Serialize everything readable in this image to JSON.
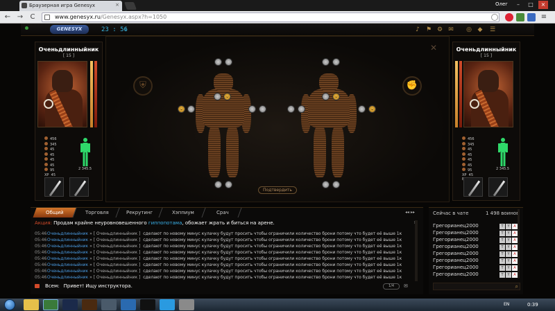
{
  "browser": {
    "tab_title": "Браузерная игра Genesyx",
    "tab_close": "×",
    "url_host": "www.genesyx.ru",
    "url_path": "/Genesyx.aspx?h=1050",
    "user_name": "Олег",
    "nav_back": "←",
    "nav_forward": "→",
    "nav_reload": "C",
    "win_min": "–",
    "win_max": "□",
    "win_close": "×"
  },
  "game": {
    "logo_text": "GENESYX",
    "clock": "23 : 56",
    "top_icons": [
      "♪",
      "⚑",
      "⚙",
      "✉",
      "◎",
      "◆",
      "☰"
    ],
    "close_label": "✕",
    "confirm_label": "Подтвердить",
    "left_badge": "⛨",
    "right_badge": "✊"
  },
  "player_left": {
    "name": "Оченьдлинныйник",
    "level": "[ 15 ]",
    "stats": [
      {
        "v": "456"
      },
      {
        "v": "345"
      },
      {
        "v": "45"
      },
      {
        "v": "45"
      },
      {
        "v": "45"
      },
      {
        "v": "45"
      },
      {
        "v": "95"
      }
    ],
    "xp_label": "XP",
    "xp": "45",
    "en_label": "EN",
    "en": "98",
    "armor_value": "2 345.5",
    "hp_color": "#e0a040",
    "bar2_color": "#b63a1a"
  },
  "player_right": {
    "name": "Оченьдлинныйник",
    "level": "[ 15 ]",
    "stats": [
      {
        "v": "456"
      },
      {
        "v": "345"
      },
      {
        "v": "45"
      },
      {
        "v": "45"
      },
      {
        "v": "45"
      },
      {
        "v": "45"
      },
      {
        "v": "95"
      }
    ],
    "xp_label": "XP",
    "xp": "45",
    "en_label": "EN",
    "en": "98",
    "armor_value": "2 345.5"
  },
  "chat": {
    "tabs": [
      "Общий",
      "Торговля",
      "Рекрутинг",
      "Хэппиум",
      "Срач"
    ],
    "active_tab": 0,
    "tab_nav": "◂◂  ▸▸",
    "promo_label": "Акция:",
    "promo_before": "Продам крайне неуровновешенного",
    "promo_link": "гиппопотама",
    "promo_after": ", обожает жрать и биться на арене.",
    "messages": [
      {
        "time": "05:46",
        "user": "Оченьдлинныйник",
        "recipient": "[ Оченьдлинныйник ]",
        "text": "сделают по новому минус кулачку будут просить чтобы ограничили количество брони потому что будет её выше 1к"
      },
      {
        "time": "05:46",
        "user": "Оченьдлинныйник",
        "recipient": "[ Оченьдлинныйник ]",
        "text": "сделают по новому минус кулачку будут просить чтобы ограничили количество брони потому что будет её выше 1к"
      },
      {
        "time": "05:46",
        "user": "Оченьдлинныйник",
        "recipient": "[ Оченьдлинныйник ]",
        "text": "сделают по новому минус кулачку будут просить чтобы ограничили количество брони потому что будет её выше 1к"
      },
      {
        "time": "05:46",
        "user": "Оченьдлинныйник",
        "recipient": "[ Оченьдлинныйник ]",
        "text": "сделают по новому минус кулачку будут просить чтобы ограничили количество брони потому что будет её выше 1к"
      },
      {
        "time": "05:46",
        "user": "Оченьдлинныйник",
        "recipient": "[ Оченьдлинныйник ]",
        "text": "сделают по новому минус кулачку будут просить чтобы ограничили количество брони потому что будет её выше 1к"
      },
      {
        "time": "05:46",
        "user": "Оченьдлинныйник",
        "recipient": "[ Оченьдлинныйник ]",
        "text": "сделают по новому минус кулачку будут просить чтобы ограничили количество брони потому что будет её выше 1к"
      },
      {
        "time": "05:46",
        "user": "Оченьдлинныйник",
        "recipient": "[ Оченьдлинныйник ]",
        "text": "сделают по новому минус кулачку будут просить чтобы ограничили количество брони потому что будет её выше 1к"
      },
      {
        "time": "05:46",
        "user": "Оченьдлинныйник",
        "recipient": "[ Оченьдлинныйник ]",
        "text": "сделают по новому минус кулачку будут просить чтобы ограничили количество брони потому что будет её выше 1к"
      },
      {
        "time": "05:46",
        "user": "Оченьдлинныйник",
        "recipient": "[ Оченьдлинныйник ]",
        "text": "сделают по новому минус кулачку будут просить чтобы ограничили количество брони потому что будет её выше 1к"
      }
    ],
    "input_to": "Всем:",
    "input_value": "Привет! Ищу инструктора.",
    "send_counter": "1/4"
  },
  "online": {
    "title": "Сейчас в чате",
    "count": "1 498 воинов",
    "users": [
      "Грегорианец2000",
      "Грегорианец2000",
      "Грегорианец2000",
      "Грегорианец2000",
      "Грегорианец2000",
      "Грегорианец2000",
      "Грегорианец2000",
      "Грегорианец2000",
      "Грегорианец2000"
    ],
    "icon_letters": [
      "T",
      "Y",
      "A"
    ]
  },
  "taskbar": {
    "lang": "EN",
    "time": "0:39"
  }
}
